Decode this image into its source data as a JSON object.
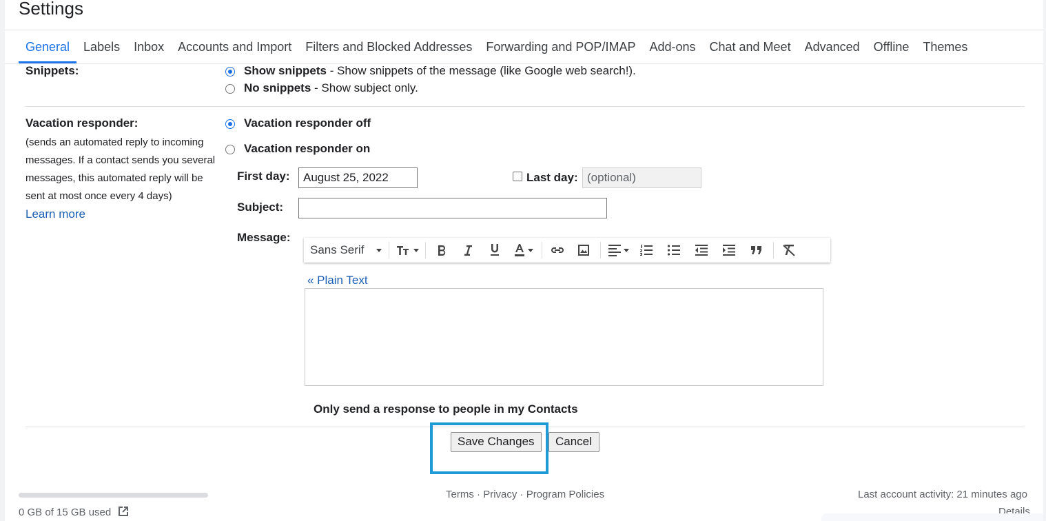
{
  "page": {
    "title": "Settings"
  },
  "tabs": [
    {
      "label": "General",
      "active": true
    },
    {
      "label": "Labels"
    },
    {
      "label": "Inbox"
    },
    {
      "label": "Accounts and Import"
    },
    {
      "label": "Filters and Blocked Addresses"
    },
    {
      "label": "Forwarding and POP/IMAP"
    },
    {
      "label": "Add-ons"
    },
    {
      "label": "Chat and Meet"
    },
    {
      "label": "Advanced"
    },
    {
      "label": "Offline"
    },
    {
      "label": "Themes"
    }
  ],
  "snippets": {
    "label": "Snippets:",
    "options": [
      {
        "title": "Show snippets",
        "desc": " - Show snippets of the message (like Google web search!).",
        "checked": true
      },
      {
        "title": "No snippets",
        "desc": " - Show subject only.",
        "checked": false
      }
    ]
  },
  "vacation": {
    "label": "Vacation responder:",
    "description": "(sends an automated reply to incoming messages. If a contact sends you several messages, this automated reply will be sent at most once every 4 days)",
    "learn_more": "Learn more",
    "off_label": "Vacation responder off",
    "on_label": "Vacation responder on",
    "selected": "off",
    "first_day_label": "First day:",
    "first_day_value": "August 25, 2022",
    "last_day_label": "Last day:",
    "last_day_placeholder": "(optional)",
    "subject_label": "Subject:",
    "subject_value": "",
    "message_label": "Message:",
    "plain_text_link": "« Plain Text",
    "contacts_only_label": "Only send a response to people in my Contacts"
  },
  "toolbar": {
    "font_name": "Sans Serif",
    "icons": [
      "font-size-icon",
      "bold-icon",
      "italic-icon",
      "underline-icon",
      "text-color-icon",
      "link-icon",
      "image-icon",
      "align-icon",
      "numbered-list-icon",
      "bulleted-list-icon",
      "indent-less-icon",
      "indent-more-icon",
      "quote-icon",
      "remove-formatting-icon"
    ]
  },
  "actions": {
    "save_label": "Save Changes",
    "cancel_label": "Cancel"
  },
  "footer": {
    "storage": "0 GB of 15 GB used",
    "storage_fraction": 0,
    "terms": "Terms",
    "dot": " · ",
    "privacy": "Privacy",
    "program_policies": "Program Policies",
    "last_activity": "Last account activity: 21 minutes ago",
    "details": "Details"
  },
  "colors": {
    "accent": "#1a73e8",
    "highlight_box": "#1e9ad6",
    "link": "#1a5fb4"
  }
}
